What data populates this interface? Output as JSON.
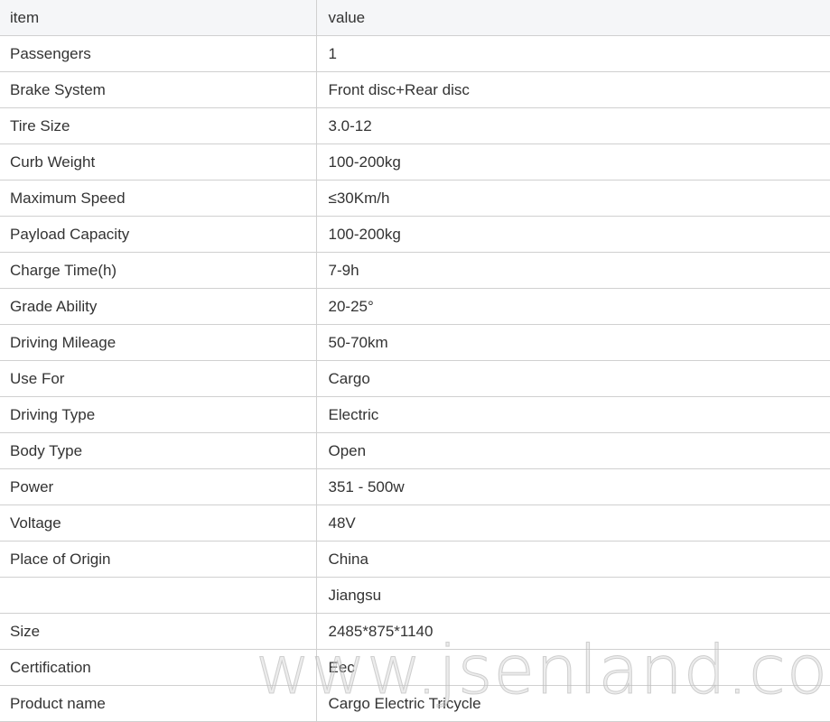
{
  "table": {
    "headers": {
      "item": "item",
      "value": "value"
    },
    "rows": [
      {
        "item": "Passengers",
        "value": "1"
      },
      {
        "item": "Brake System",
        "value": "Front disc+Rear disc"
      },
      {
        "item": "Tire Size",
        "value": "3.0-12"
      },
      {
        "item": "Curb Weight",
        "value": "100-200kg"
      },
      {
        "item": "Maximum Speed",
        "value": "≤30Km/h"
      },
      {
        "item": "Payload Capacity",
        "value": "100-200kg"
      },
      {
        "item": "Charge Time(h)",
        "value": "7-9h"
      },
      {
        "item": "Grade Ability",
        "value": "20-25°"
      },
      {
        "item": "Driving Mileage",
        "value": "50-70km"
      },
      {
        "item": "Use For",
        "value": "Cargo"
      },
      {
        "item": "Driving Type",
        "value": "Electric"
      },
      {
        "item": "Body Type",
        "value": "Open"
      },
      {
        "item": "Power",
        "value": "351 - 500w"
      },
      {
        "item": "Voltage",
        "value": "48V"
      },
      {
        "item": "Place of Origin",
        "value": "China"
      },
      {
        "item": "",
        "value": "Jiangsu"
      },
      {
        "item": "Size",
        "value": "2485*875*1140"
      },
      {
        "item": "Certification",
        "value": "Eec"
      },
      {
        "item": "Product name",
        "value": "Cargo Electric Tricycle"
      }
    ]
  },
  "watermark": "www.jsenland.com"
}
